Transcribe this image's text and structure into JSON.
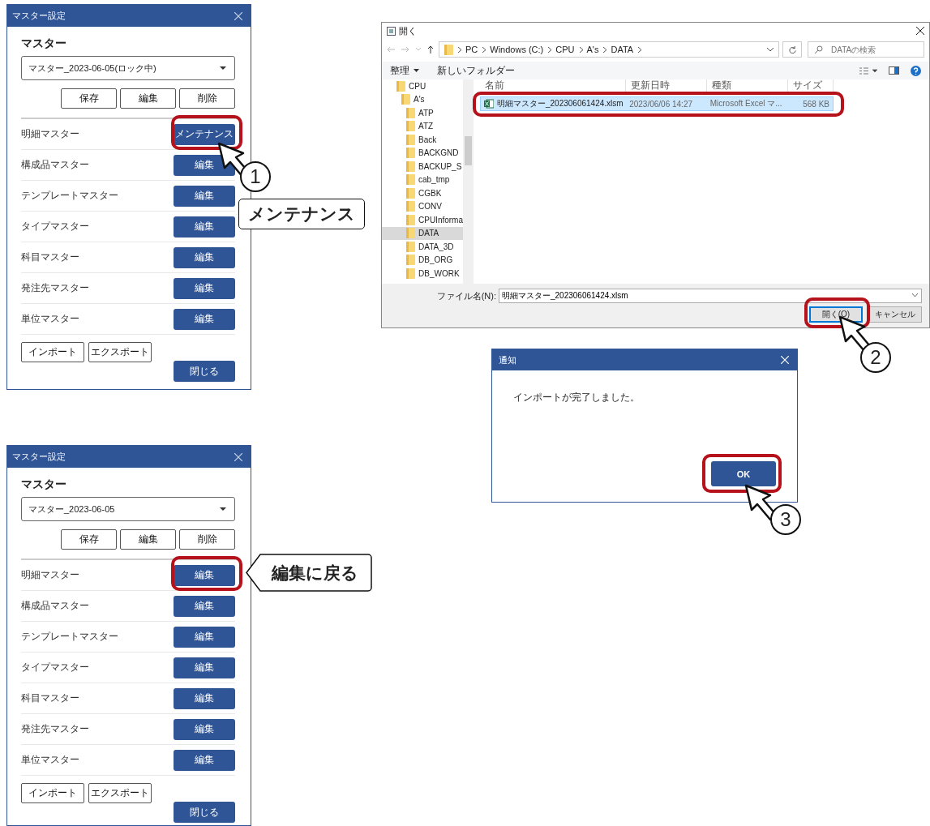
{
  "master_dialogs": [
    {
      "title": "マスター設定",
      "heading": "マスター",
      "dropdown_value": "マスター_2023-06-05(ロック中)",
      "action_buttons": [
        "保存",
        "編集",
        "削除"
      ],
      "rows": [
        {
          "label": "明細マスター",
          "button": "メンテナンス"
        },
        {
          "label": "構成品マスター",
          "button": "編集"
        },
        {
          "label": "テンプレートマスター",
          "button": "編集"
        },
        {
          "label": "タイプマスター",
          "button": "編集"
        },
        {
          "label": "科目マスター",
          "button": "編集"
        },
        {
          "label": "発注先マスター",
          "button": "編集"
        },
        {
          "label": "単位マスター",
          "button": "編集"
        }
      ],
      "io_buttons": [
        "インポート",
        "エクスポート"
      ],
      "close_button": "閉じる"
    },
    {
      "title": "マスター設定",
      "heading": "マスター",
      "dropdown_value": "マスター_2023-06-05",
      "action_buttons": [
        "保存",
        "編集",
        "削除"
      ],
      "rows": [
        {
          "label": "明細マスター",
          "button": "編集"
        },
        {
          "label": "構成品マスター",
          "button": "編集"
        },
        {
          "label": "テンプレートマスター",
          "button": "編集"
        },
        {
          "label": "タイプマスター",
          "button": "編集"
        },
        {
          "label": "科目マスター",
          "button": "編集"
        },
        {
          "label": "発注先マスター",
          "button": "編集"
        },
        {
          "label": "単位マスター",
          "button": "編集"
        }
      ],
      "io_buttons": [
        "インポート",
        "エクスポート"
      ],
      "close_button": "閉じる"
    }
  ],
  "file_dialog": {
    "title": "開く",
    "breadcrumb": [
      "PC",
      "Windows (C:)",
      "CPU",
      "A's",
      "DATA"
    ],
    "search": {
      "placeholder": "DATAの検索"
    },
    "toolbar": [
      "整理",
      "新しいフォルダー"
    ],
    "tree": [
      {
        "label": "CPU",
        "selected": false,
        "children": [
          {
            "label": "A's",
            "selected": false,
            "children": [
              {
                "label": "ATP",
                "selected": false
              },
              {
                "label": "ATZ",
                "selected": false
              },
              {
                "label": "Back",
                "selected": false
              },
              {
                "label": "BACKGND",
                "selected": false
              },
              {
                "label": "BACKUP_S",
                "selected": false
              },
              {
                "label": "cab_tmp",
                "selected": false
              },
              {
                "label": "CGBK",
                "selected": false
              },
              {
                "label": "CONV",
                "selected": false
              },
              {
                "label": "CPUInforma",
                "selected": false
              },
              {
                "label": "DATA",
                "selected": true
              },
              {
                "label": "DATA_3D",
                "selected": false
              },
              {
                "label": "DB_ORG",
                "selected": false
              },
              {
                "label": "DB_WORK",
                "selected": false
              }
            ]
          }
        ]
      }
    ],
    "columns": [
      "名前",
      "更新日時",
      "種類",
      "サイズ"
    ],
    "files": [
      {
        "name": "明細マスター_202306061424.xlsm",
        "modified": "2023/06/06 14:27",
        "type": "Microsoft Excel マ...",
        "size": "568 KB",
        "selected": true
      }
    ],
    "filename_label": "ファイル名(N):",
    "filename_value": "明細マスター_202306061424.xlsm",
    "buttons": [
      "開く(O)",
      "キャンセル"
    ]
  },
  "notification": {
    "title": "通知",
    "message": "インポートが完了しました。",
    "button": "OK"
  },
  "annotations": {
    "step_badges": [
      "1",
      "2",
      "3"
    ],
    "callouts": [
      "メンテナンス",
      "編集に戻る"
    ]
  }
}
